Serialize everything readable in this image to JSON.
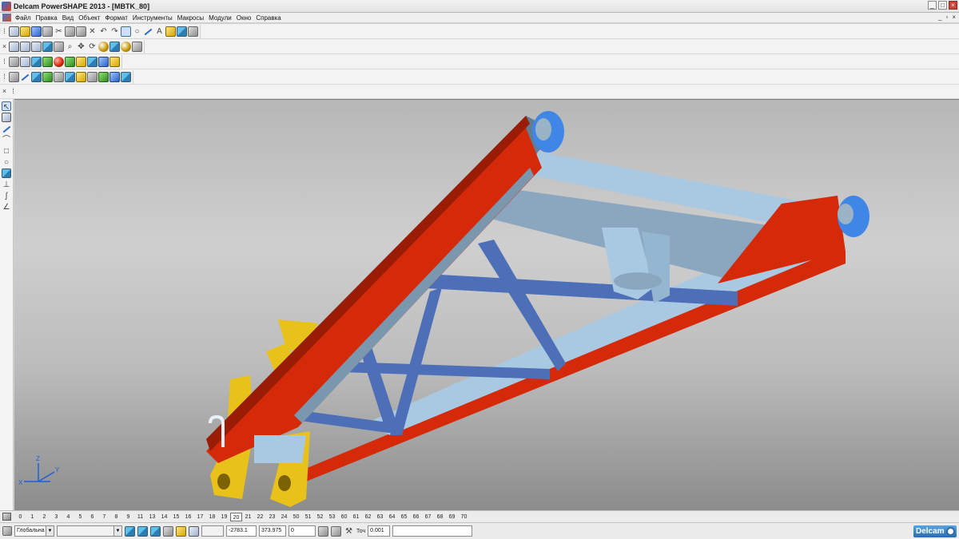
{
  "window": {
    "title": "Delcam PowerSHAPE 2013 - [MBTK_80]",
    "controls": [
      "_",
      "□",
      "×"
    ],
    "mdi_controls": [
      "_",
      "▫",
      "×"
    ]
  },
  "menu": [
    "Файл",
    "Правка",
    "Вид",
    "Объект",
    "Формат",
    "Инструменты",
    "Макросы",
    "Модули",
    "Окно",
    "Справка"
  ],
  "toolbars": {
    "main_icons": [
      "new-file-icon",
      "open-file-icon",
      "save-icon",
      "print-icon",
      "cut-icon",
      "copy-icon",
      "paste-icon",
      "delete-icon",
      "undo-icon",
      "redo-icon",
      "select-icon",
      "circle-icon",
      "curve-icon",
      "text-icon",
      "light-icon",
      "cube-icon",
      "tools-icon"
    ],
    "view_icons": [
      "view-front-icon",
      "view-top-icon",
      "view-iso-icon",
      "zoom-in-icon",
      "zoom-out-icon",
      "pan-icon",
      "rotate-icon",
      "shaded-icon",
      "wireframe-icon"
    ],
    "solid_icons": [
      "solid-box-icon",
      "solid-cylinder-icon",
      "solid-sphere-icon",
      "feature-icon",
      "boolean-icon"
    ],
    "surface_icons": [
      "surface-icon",
      "trim-icon",
      "blend-icon",
      "shell-icon"
    ]
  },
  "left_toolbar_icons": [
    "select-arrow-icon",
    "workplane-icon",
    "line-icon",
    "arc-icon",
    "rectangle-icon",
    "circle-icon",
    "solid-icon",
    "dimension-icon",
    "curve-icon",
    "angle-icon"
  ],
  "viewport": {
    "axis_labels": {
      "x": "X",
      "y": "Y",
      "z": "Z"
    },
    "colors": {
      "beam_top": "#5e7f97",
      "beam_side": "#d42a0a",
      "plate_light": "#a9c9e3",
      "cross_bar": "#4d6fb8",
      "bracket_yellow": "#e8c21a",
      "pin_blue": "#3f86e6"
    }
  },
  "levels": {
    "items": [
      "0",
      "1",
      "2",
      "3",
      "4",
      "5",
      "6",
      "7",
      "8",
      "9",
      "11",
      "13",
      "14",
      "15",
      "16",
      "17",
      "18",
      "19",
      "20",
      "21",
      "22",
      "23",
      "24",
      "50",
      "51",
      "52",
      "53",
      "60",
      "61",
      "62",
      "63",
      "64",
      "65",
      "66",
      "67",
      "68",
      "69",
      "70"
    ],
    "active": "20"
  },
  "status": {
    "coord_system": "Глобальна",
    "x": "-2783.1",
    "y": "373.975",
    "z": "0",
    "tolerance_label": "Точ",
    "tolerance_value": "0.001",
    "brand": "Delcam"
  }
}
